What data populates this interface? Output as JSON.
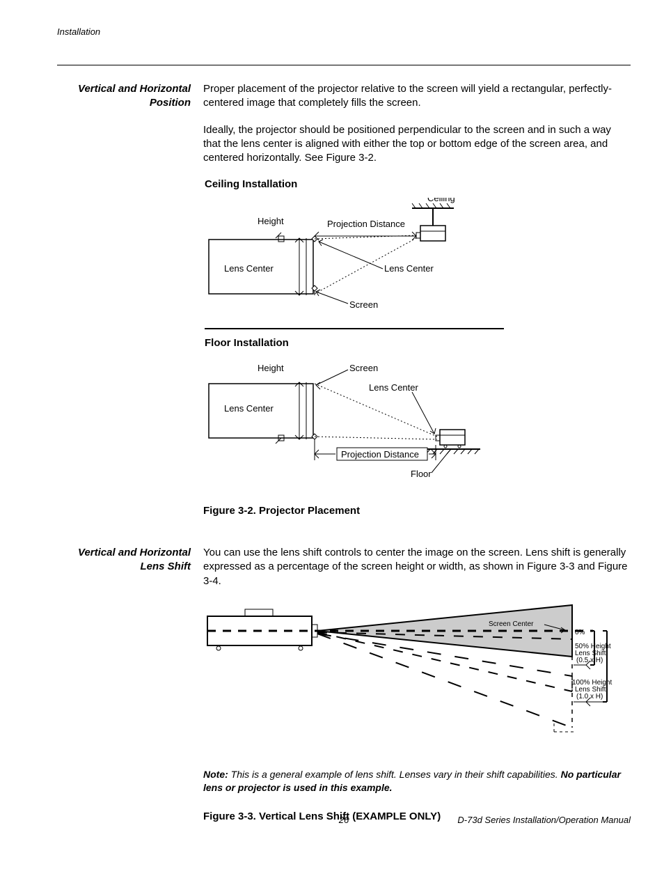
{
  "header": {
    "running": "Installation"
  },
  "section1": {
    "side_heading": "Vertical and Horizontal Position",
    "p1": "Proper placement of the projector relative to the screen will yield a rectangular, perfectly-centered image that completely fills the screen.",
    "p2": "Ideally, the projector should be positioned perpendicular to the screen and in such a way that the lens center is aligned with either the top or bottom edge of the screen area, and centered horizontally. See Figure 3-2."
  },
  "fig32": {
    "ceiling_title": "Ceiling Installation",
    "floor_title": "Floor Installation",
    "labels": {
      "ceiling": "Ceiling",
      "height": "Height",
      "projection_distance": "Projection Distance",
      "lens_center": "Lens Center",
      "screen": "Screen",
      "floor": "Floor"
    },
    "caption": "Figure 3-2. Projector Placement"
  },
  "section2": {
    "side_heading": "Vertical and Horizontal Lens Shift",
    "p1": "You can use the lens shift controls to center the image on the screen. Lens shift is generally expressed as a percentage of the screen height or width, as shown in Figure 3-3 and Figure 3-4."
  },
  "fig33": {
    "labels": {
      "screen_center": "Screen Center",
      "zero_pct": "0%",
      "fifty_line1": "50% Height",
      "fifty_line2": "Lens Shift",
      "fifty_line3": "(0.5 x H)",
      "hundred_line1": "100% Height",
      "hundred_line2": "Lens Shift",
      "hundred_line3": "(1.0 x H)"
    },
    "note_label": "Note:",
    "note_body": " This is a general example of lens shift. Lenses vary in their shift capabilities. ",
    "note_strong": "No particular lens or projector is used in this example.",
    "caption": "Figure 3-3. Vertical Lens Shift (EXAMPLE ONLY)"
  },
  "footer": {
    "page_num": "26",
    "doc_title": "D-73d Series Installation/Operation Manual"
  }
}
